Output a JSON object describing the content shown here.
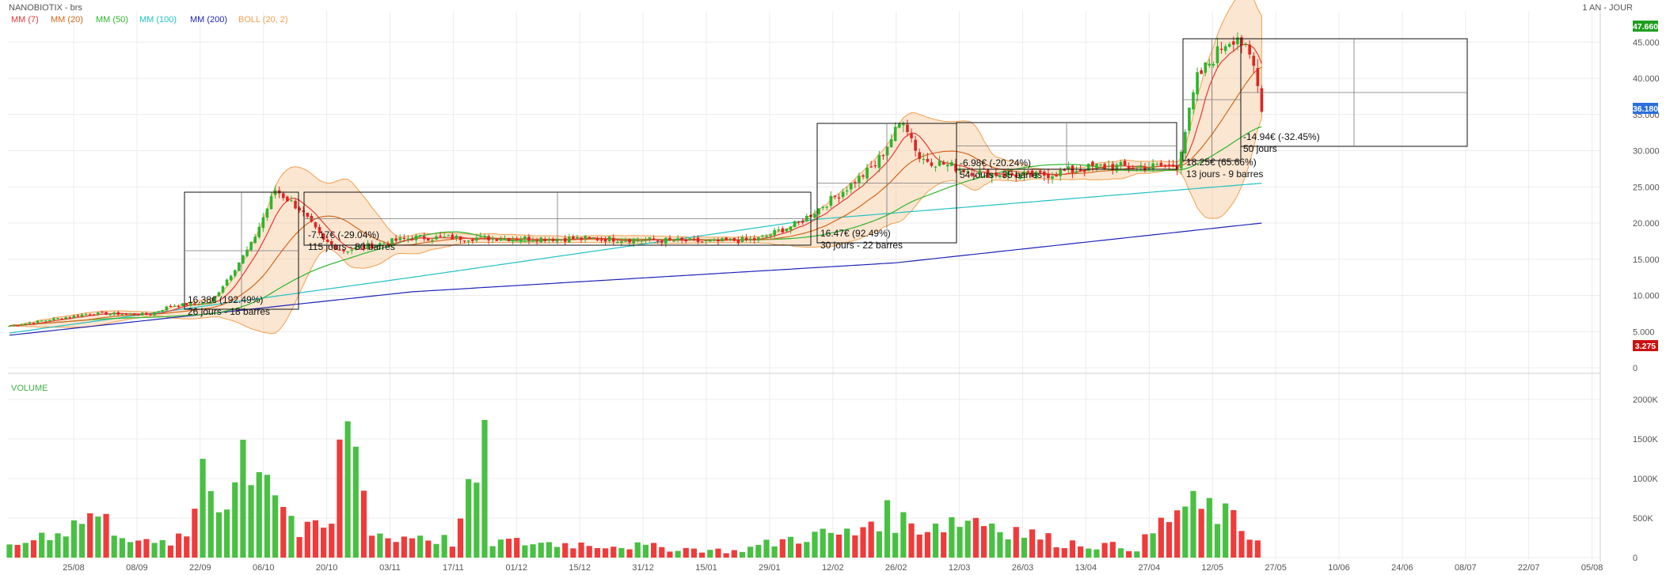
{
  "header": {
    "symbol": "NANOBIOTIX - brs",
    "period": "1 AN - JOUR"
  },
  "legend": [
    {
      "label": "MM (7)",
      "color": "#e53935"
    },
    {
      "label": "MM (20)",
      "color": "#d2691e"
    },
    {
      "label": "MM (50)",
      "color": "#2db52d"
    },
    {
      "label": "MM (100)",
      "color": "#22c1c3"
    },
    {
      "label": "MM (200)",
      "color": "#1f24b8"
    },
    {
      "label": "BOLL (20, 2)",
      "color": "#f0a050"
    }
  ],
  "price_badges": {
    "high": {
      "value": "47.660",
      "color": "#1e9e1e"
    },
    "last": {
      "value": "36.180",
      "color": "#2a6fdb"
    },
    "low": {
      "value": "3.275",
      "color": "#cc1111"
    }
  },
  "volume_label": "VOLUME",
  "annotations": [
    {
      "line1": "16.38€ (192.49%)",
      "line2": "26 jours - 18 barres"
    },
    {
      "line1": "-7.17€ (-29.04%)",
      "line2": "115 jours - 80 barres"
    },
    {
      "line1": "16.47€ (92.49%)",
      "line2": "30 jours - 22 barres"
    },
    {
      "line1": "-6.98€ (-20.24%)",
      "line2": "54 jours - 35 barres"
    },
    {
      "line1": "18.25€ (65.66%)",
      "line2": "13 jours - 9 barres"
    },
    {
      "line1": "-14.94€ (-32.45%)",
      "line2": "50 jours"
    }
  ],
  "chart_data": {
    "type": "candlestick",
    "title": "NANOBIOTIX - brs",
    "period": "1 AN - JOUR",
    "x_ticks": [
      "25/08",
      "08/09",
      "22/09",
      "06/10",
      "20/10",
      "03/11",
      "17/11",
      "01/12",
      "15/12",
      "31/12",
      "15/01",
      "29/01",
      "12/02",
      "26/02",
      "12/03",
      "26/03",
      "13/04",
      "27/04",
      "12/05",
      "27/05",
      "10/06",
      "24/06",
      "08/07",
      "22/07",
      "05/08"
    ],
    "price_axis": {
      "ticks": [
        "0",
        "5.000",
        "10.000",
        "15.000",
        "20.000",
        "25.000",
        "30.000",
        "35.000",
        "40.000",
        "45.000"
      ],
      "ylim": [
        0,
        48
      ]
    },
    "volume_axis": {
      "ticks": [
        "0",
        "500K",
        "1000K",
        "1500K",
        "2000K"
      ],
      "ylim": [
        0,
        2200000
      ]
    },
    "close_anchors": [
      [
        0,
        5.8
      ],
      [
        20,
        7.5
      ],
      [
        35,
        7.4
      ],
      [
        40,
        8.6
      ],
      [
        50,
        9.0
      ],
      [
        60,
        17
      ],
      [
        66,
        24.6
      ],
      [
        72,
        22
      ],
      [
        78,
        17.5
      ],
      [
        83,
        16.2
      ],
      [
        100,
        18.0
      ],
      [
        150,
        17.8
      ],
      [
        175,
        17.4
      ],
      [
        186,
        17.8
      ],
      [
        196,
        20
      ],
      [
        206,
        24
      ],
      [
        215,
        28
      ],
      [
        222,
        34.5
      ],
      [
        226,
        29
      ],
      [
        240,
        27
      ],
      [
        255,
        26.5
      ],
      [
        270,
        27.8
      ],
      [
        285,
        27.8
      ],
      [
        290,
        28
      ],
      [
        295,
        40
      ],
      [
        302,
        45
      ],
      [
        305,
        46
      ],
      [
        309,
        41.5
      ],
      [
        311,
        36.2
      ]
    ],
    "moving_averages": [
      {
        "name": "MM (7)",
        "color": "#e53935"
      },
      {
        "name": "MM (20)",
        "color": "#d2691e"
      },
      {
        "name": "MM (50)",
        "color": "#2db52d"
      },
      {
        "name": "MM (100)",
        "color": "#22c1c3",
        "values_at": [
          [
            0,
            4.8
          ],
          [
            100,
            12.5
          ],
          [
            200,
            20.5
          ],
          [
            311,
            25.5
          ]
        ]
      },
      {
        "name": "MM (200)",
        "color": "#1f24b8",
        "values_at": [
          [
            0,
            4.5
          ],
          [
            100,
            10.5
          ],
          [
            220,
            14.5
          ],
          [
            311,
            20
          ]
        ]
      }
    ],
    "volume_profile": [
      [
        0,
        120000
      ],
      [
        10,
        330000
      ],
      [
        15,
        380000
      ],
      [
        20,
        550000
      ],
      [
        35,
        150000
      ],
      [
        45,
        250000
      ],
      [
        48,
        1400000
      ],
      [
        50,
        900000
      ],
      [
        55,
        700000
      ],
      [
        58,
        1400000
      ],
      [
        62,
        1200000
      ],
      [
        64,
        1300000
      ],
      [
        66,
        900000
      ],
      [
        68,
        700000
      ],
      [
        72,
        300000
      ],
      [
        80,
        400000
      ],
      [
        84,
        2050000
      ],
      [
        86,
        1300000
      ],
      [
        90,
        400000
      ],
      [
        95,
        200000
      ],
      [
        100,
        300000
      ],
      [
        110,
        200000
      ],
      [
        118,
        1250000
      ],
      [
        120,
        200000
      ],
      [
        150,
        160000
      ],
      [
        180,
        80000
      ],
      [
        198,
        280000
      ],
      [
        210,
        300000
      ],
      [
        215,
        550000
      ],
      [
        220,
        500000
      ],
      [
        225,
        400000
      ],
      [
        240,
        500000
      ],
      [
        260,
        200000
      ],
      [
        280,
        120000
      ],
      [
        290,
        600000
      ],
      [
        295,
        620000
      ],
      [
        300,
        580000
      ],
      [
        305,
        400000
      ],
      [
        311,
        200000
      ]
    ]
  }
}
